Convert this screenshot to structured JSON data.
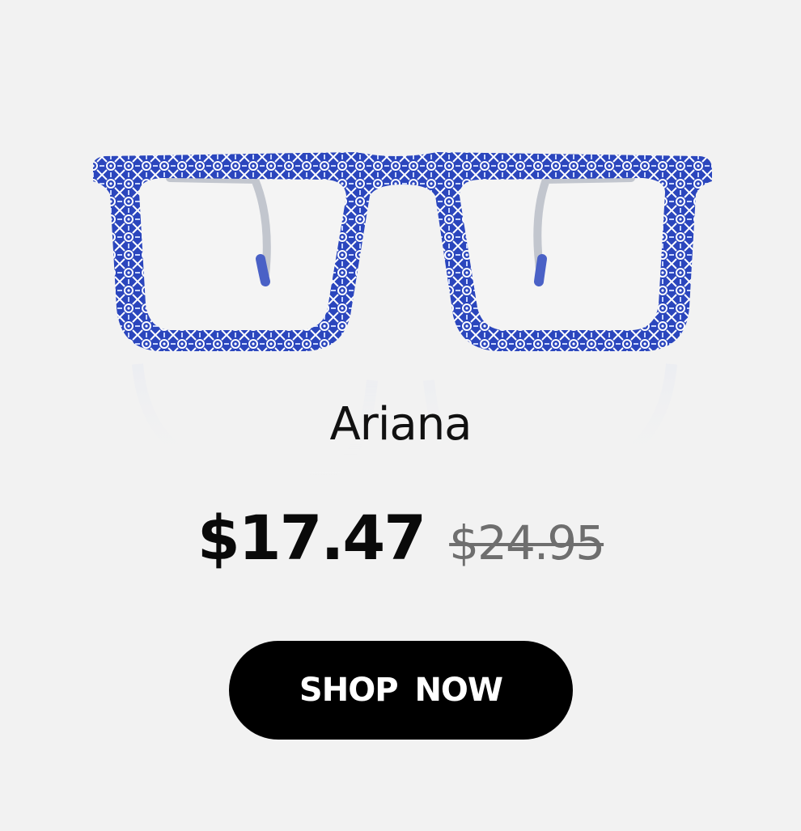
{
  "product": {
    "image_icon": "blue-pattern-eyeglasses",
    "name": "Ariana",
    "price_current": "$17.47",
    "price_original": "$24.95"
  },
  "cta": {
    "label": "SHOP NOW"
  },
  "colors": {
    "background": "#f2f2f2",
    "frame_blue": "#2a44b8",
    "button": "#000000",
    "button_text": "#ffffff",
    "original_price": "#6e6e6e"
  }
}
